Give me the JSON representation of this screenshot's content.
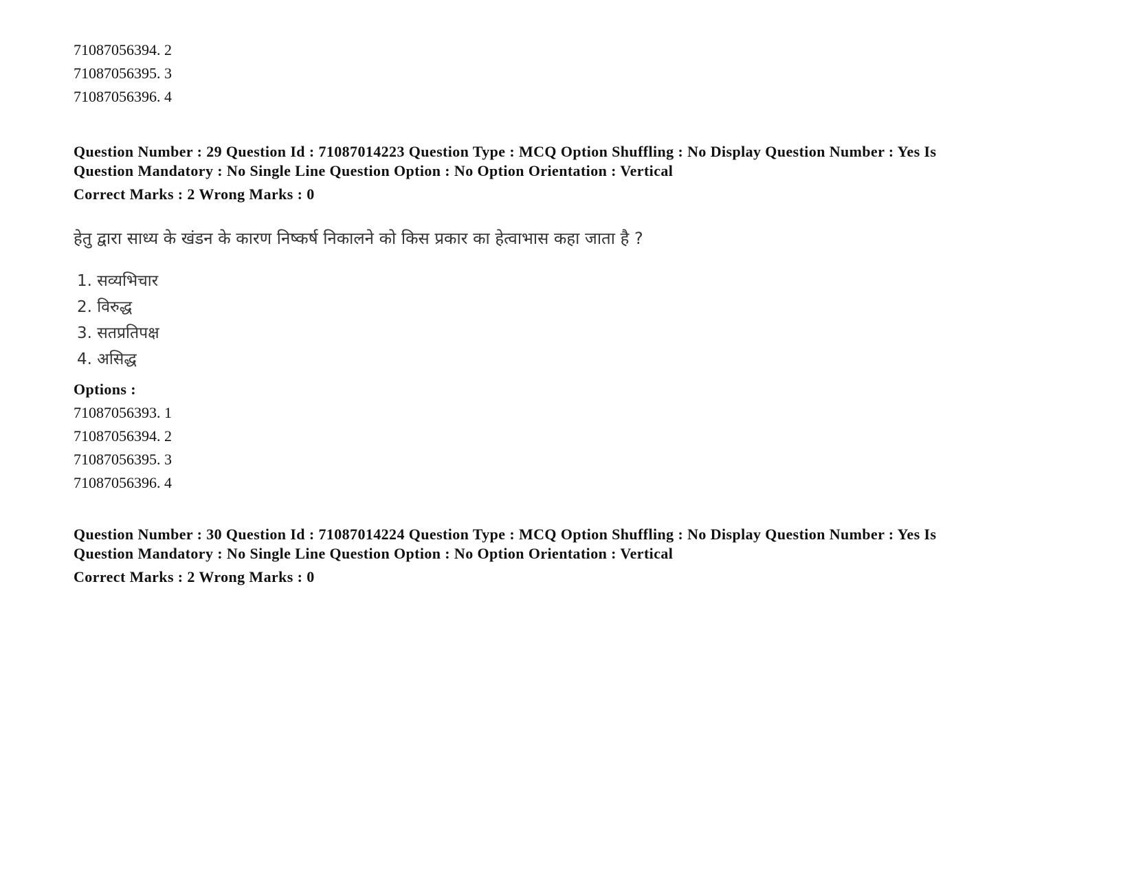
{
  "prev_options": [
    "71087056394. 2",
    "71087056395. 3",
    "71087056396. 4"
  ],
  "q29": {
    "header_line1": "Question Number : 29 Question Id : 71087014223 Question Type : MCQ Option Shuffling : No Display Question Number : Yes Is",
    "header_line2": "Question Mandatory : No Single Line Question Option : No Option Orientation : Vertical",
    "marks": "Correct Marks : 2 Wrong Marks : 0",
    "question_text": "हेतु द्वारा साध्य के खंडन के कारण निष्कर्ष निकालने को किस प्रकार का हेत्वाभास कहा जाता है ?",
    "choices": [
      "1. सव्यभिचार",
      "2. विरुद्ध",
      "3. सतप्रतिपक्ष",
      "4. असिद्ध"
    ],
    "options_label": "Options :",
    "option_ids": [
      "71087056393. 1",
      "71087056394. 2",
      "71087056395. 3",
      "71087056396. 4"
    ]
  },
  "q30": {
    "header_line1": "Question Number : 30 Question Id : 71087014224 Question Type : MCQ Option Shuffling : No Display Question Number : Yes Is",
    "header_line2": "Question Mandatory : No Single Line Question Option : No Option Orientation : Vertical",
    "marks": "Correct Marks : 2 Wrong Marks : 0"
  }
}
